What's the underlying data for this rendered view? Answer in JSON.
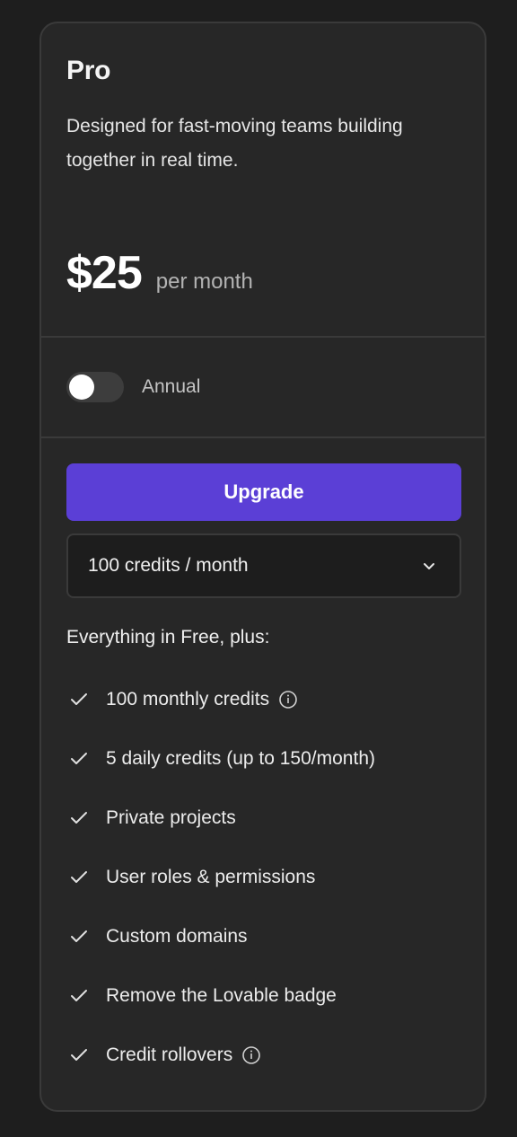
{
  "plan": {
    "name": "Pro",
    "description": "Designed for fast-moving teams building together in real time.",
    "price": "$25",
    "period": "per month"
  },
  "billing_toggle": {
    "label": "Annual",
    "checked": false
  },
  "upgrade_button": {
    "label": "Upgrade",
    "color": "#5b3fd6"
  },
  "credits_select": {
    "value": "100 credits / month"
  },
  "features": {
    "title": "Everything in Free, plus:",
    "items": [
      {
        "label": "100 monthly credits",
        "has_info": true
      },
      {
        "label": "5 daily credits (up to 150/month)",
        "has_info": false
      },
      {
        "label": "Private projects",
        "has_info": false
      },
      {
        "label": "User roles & permissions",
        "has_info": false
      },
      {
        "label": "Custom domains",
        "has_info": false
      },
      {
        "label": "Remove the Lovable badge",
        "has_info": false
      },
      {
        "label": "Credit rollovers",
        "has_info": true
      }
    ]
  },
  "icons": {
    "check": "check-icon",
    "info": "info-icon",
    "chevron": "chevron-down-icon"
  }
}
